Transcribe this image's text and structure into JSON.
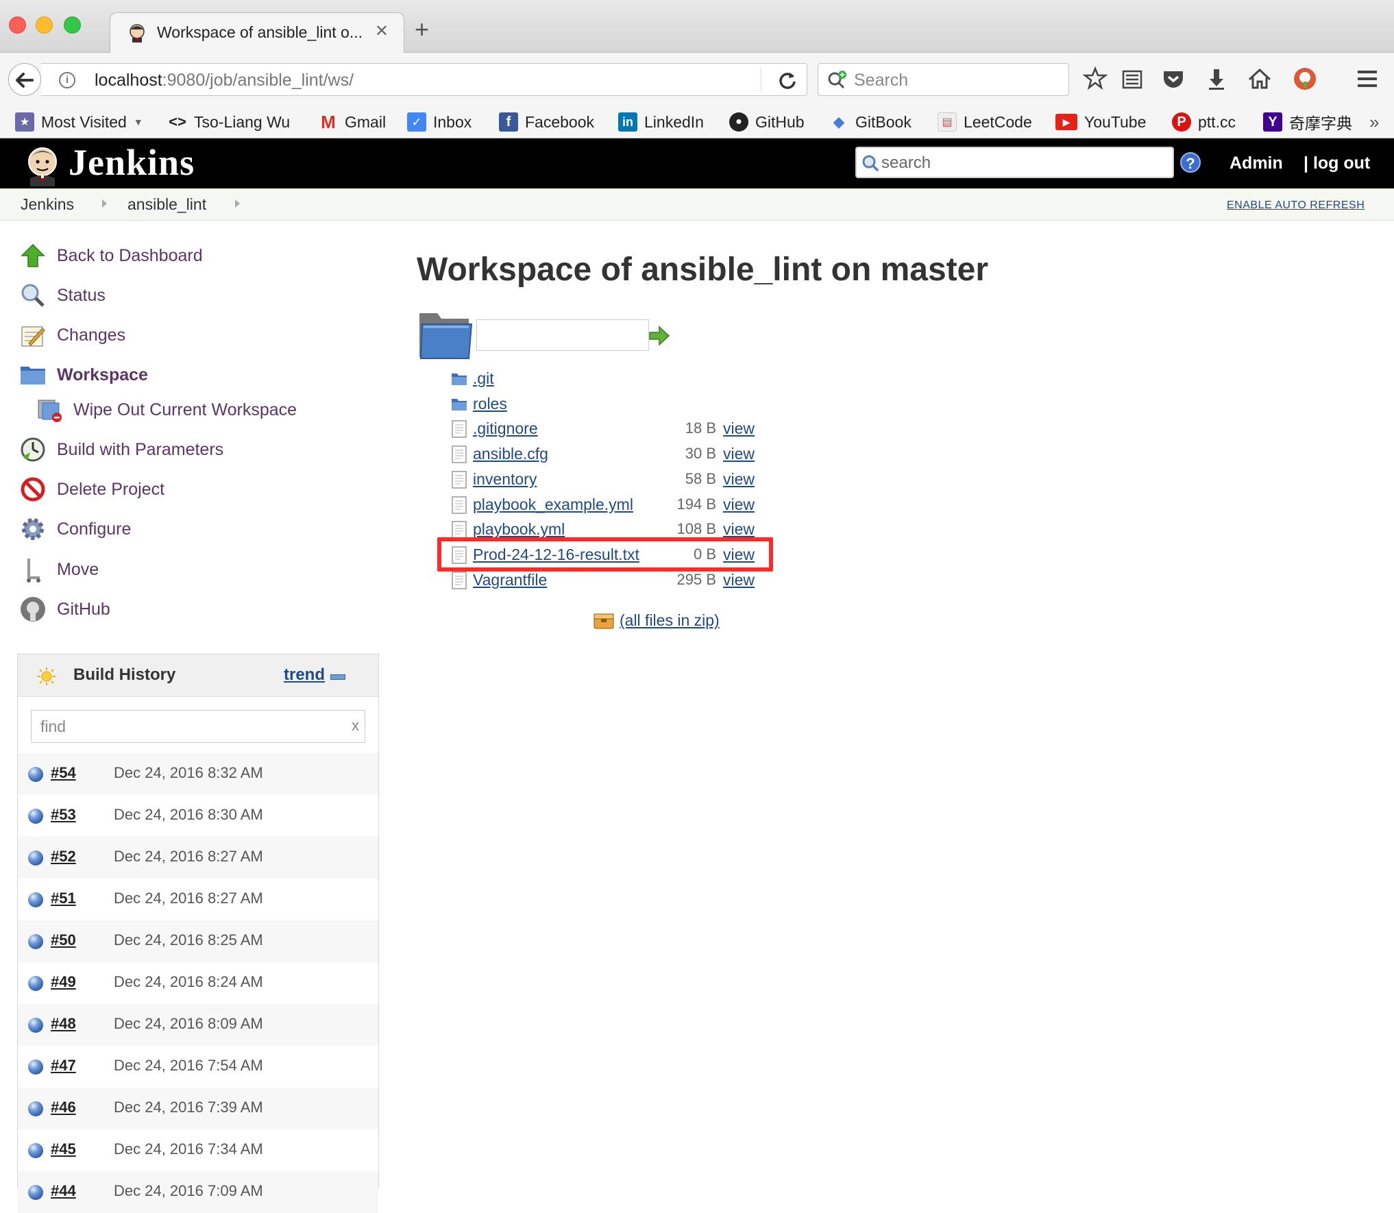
{
  "browser": {
    "tab_title": "Workspace of ansible_lint o...",
    "url_host": "localhost",
    "url_rest": ":9080/job/ansible_lint/ws/",
    "search_placeholder": "Search",
    "bookmarks": [
      {
        "label": "Most Visited",
        "icon": "most-visited-icon"
      },
      {
        "label": "Tso-Liang Wu",
        "icon": "code-icon"
      },
      {
        "label": "Gmail",
        "icon": "gmail-icon"
      },
      {
        "label": "Inbox",
        "icon": "inbox-icon"
      },
      {
        "label": "Facebook",
        "icon": "facebook-icon"
      },
      {
        "label": "LinkedIn",
        "icon": "linkedin-icon"
      },
      {
        "label": "GitHub",
        "icon": "github-icon"
      },
      {
        "label": "GitBook",
        "icon": "gitbook-icon"
      },
      {
        "label": "LeetCode",
        "icon": "leetcode-icon"
      },
      {
        "label": "YouTube",
        "icon": "youtube-icon"
      },
      {
        "label": "ptt.cc",
        "icon": "ptt-icon"
      },
      {
        "label": "奇摩字典",
        "icon": "yahoo-icon"
      }
    ]
  },
  "jenkins": {
    "title": "Jenkins",
    "search_placeholder": "search",
    "user": "Admin",
    "logout": "log out",
    "breadcrumbs": [
      "Jenkins",
      "ansible_lint"
    ],
    "auto_refresh": "ENABLE AUTO REFRESH"
  },
  "sidebar": {
    "tasks": [
      {
        "label": "Back to Dashboard",
        "icon": "up-arrow-icon"
      },
      {
        "label": "Status",
        "icon": "magnifier-icon"
      },
      {
        "label": "Changes",
        "icon": "notepad-icon"
      },
      {
        "label": "Workspace",
        "icon": "folder-icon"
      },
      {
        "label": "Wipe Out Current Workspace",
        "icon": "wipe-folder-icon"
      },
      {
        "label": "Build with Parameters",
        "icon": "clock-icon"
      },
      {
        "label": "Delete Project",
        "icon": "no-entry-icon"
      },
      {
        "label": "Configure",
        "icon": "gear-icon"
      },
      {
        "label": "Move",
        "icon": "move-icon"
      },
      {
        "label": "GitHub",
        "icon": "github-icon"
      }
    ]
  },
  "build_history": {
    "title": "Build History",
    "trend": "trend",
    "find_placeholder": "find",
    "clear": "x",
    "builds": [
      {
        "num": "#54",
        "date": "Dec 24, 2016 8:32 AM"
      },
      {
        "num": "#53",
        "date": "Dec 24, 2016 8:30 AM"
      },
      {
        "num": "#52",
        "date": "Dec 24, 2016 8:27 AM"
      },
      {
        "num": "#51",
        "date": "Dec 24, 2016 8:27 AM"
      },
      {
        "num": "#50",
        "date": "Dec 24, 2016 8:25 AM"
      },
      {
        "num": "#49",
        "date": "Dec 24, 2016 8:24 AM"
      },
      {
        "num": "#48",
        "date": "Dec 24, 2016 8:09 AM"
      },
      {
        "num": "#47",
        "date": "Dec 24, 2016 7:54 AM"
      },
      {
        "num": "#46",
        "date": "Dec 24, 2016 7:39 AM"
      },
      {
        "num": "#45",
        "date": "Dec 24, 2016 7:34 AM"
      },
      {
        "num": "#44",
        "date": "Dec 24, 2016 7:09 AM"
      }
    ]
  },
  "main": {
    "title": "Workspace of ansible_lint on master",
    "files": [
      {
        "name": ".git",
        "type": "dir",
        "size": "",
        "view": ""
      },
      {
        "name": "roles",
        "type": "dir",
        "size": "",
        "view": ""
      },
      {
        "name": ".gitignore",
        "type": "file",
        "size": "18 B",
        "view": "view"
      },
      {
        "name": "ansible.cfg",
        "type": "file",
        "size": "30 B",
        "view": "view"
      },
      {
        "name": "inventory",
        "type": "file",
        "size": "58 B",
        "view": "view"
      },
      {
        "name": "playbook_example.yml",
        "type": "file",
        "size": "194 B",
        "view": "view"
      },
      {
        "name": "playbook.yml",
        "type": "file",
        "size": "108 B",
        "view": "view"
      },
      {
        "name": "Prod-24-12-16-result.txt",
        "type": "file",
        "size": "0 B",
        "view": "view"
      },
      {
        "name": "Vagrantfile",
        "type": "file",
        "size": "295 B",
        "view": "view"
      }
    ],
    "zip_link": "(all files in zip)"
  },
  "colors": {
    "link": "#204a87",
    "task_link": "#5c3566",
    "highlight": "#ff2a2a"
  }
}
